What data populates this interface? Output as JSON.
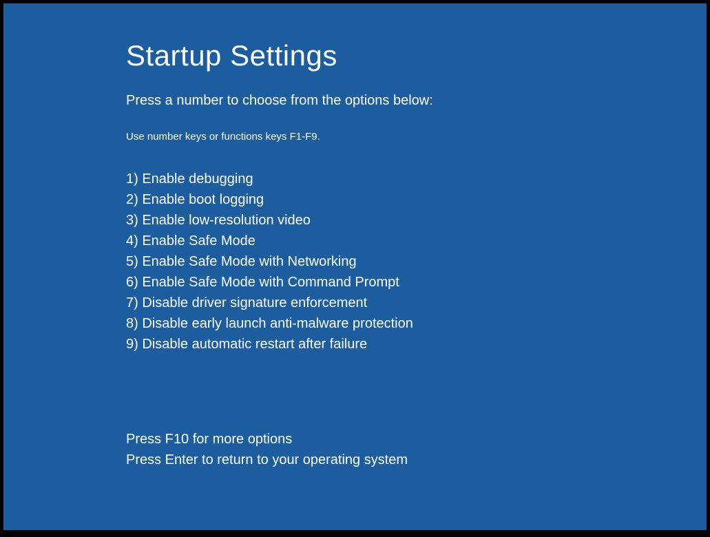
{
  "title": "Startup Settings",
  "instruction": "Press a number to choose from the options below:",
  "hint": "Use number keys or functions keys F1-F9.",
  "options": [
    "1) Enable debugging",
    "2) Enable boot logging",
    "3) Enable low-resolution video",
    "4) Enable Safe Mode",
    "5) Enable Safe Mode with Networking",
    "6) Enable Safe Mode with Command Prompt",
    "7) Disable driver signature enforcement",
    "8) Disable early launch anti-malware protection",
    "9) Disable automatic restart after failure"
  ],
  "footer": {
    "more_options": "Press F10 for more options",
    "return": "Press Enter to return to your operating system"
  }
}
